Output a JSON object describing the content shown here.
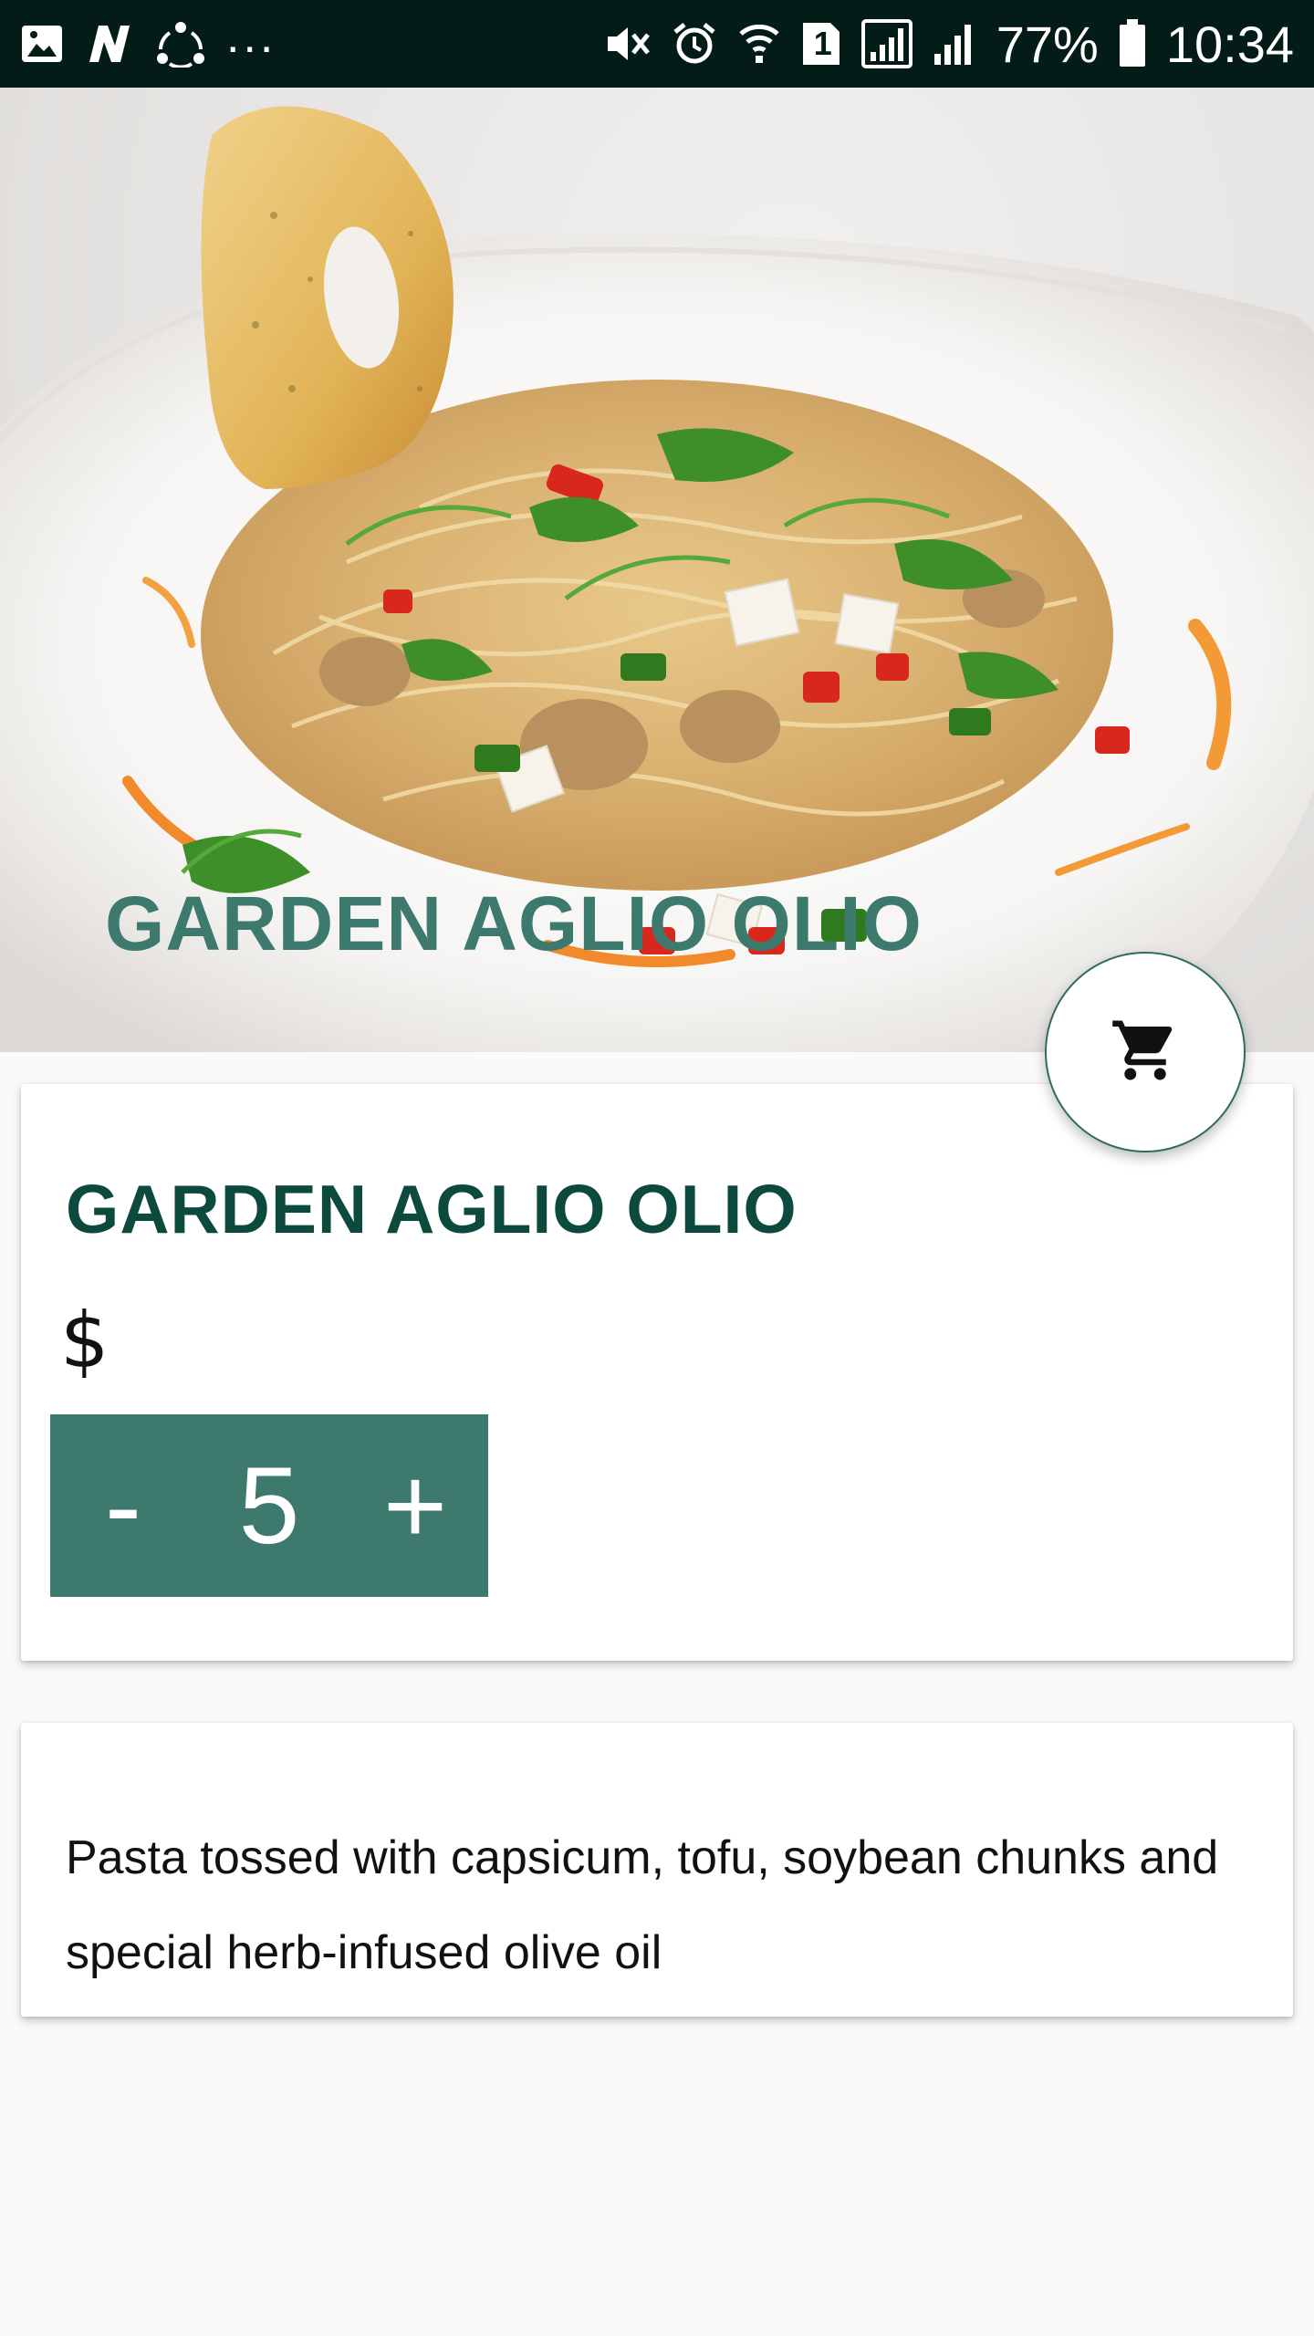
{
  "status_bar": {
    "left_icons": [
      "gallery-icon",
      "n-app-icon",
      "share-sync-icon"
    ],
    "more": "...",
    "right_icons": [
      "mute-icon",
      "alarm-icon",
      "wifi-icon",
      "sim1-icon",
      "signal-box-icon",
      "signal-icon",
      "battery-icon"
    ],
    "sim_badge": "1",
    "battery_percent": "77%",
    "time": "10:34"
  },
  "hero": {
    "title": "GARDEN AGLIO OLIO",
    "image": "pasta-dish-photo"
  },
  "cart_button": {
    "icon": "cart-icon"
  },
  "product": {
    "name": "GARDEN AGLIO OLIO",
    "price": "$",
    "quantity": {
      "decrement_label": "-",
      "value": "5",
      "increment_label": "+"
    }
  },
  "description": {
    "text": "Pasta tossed with capsicum, tofu, soybean chunks and special herb-infused olive oil"
  },
  "colors": {
    "status_bar": "#031c17",
    "accent": "#3d7a6d",
    "title_dark": "#0b4a3d",
    "background": "#fafafa"
  }
}
